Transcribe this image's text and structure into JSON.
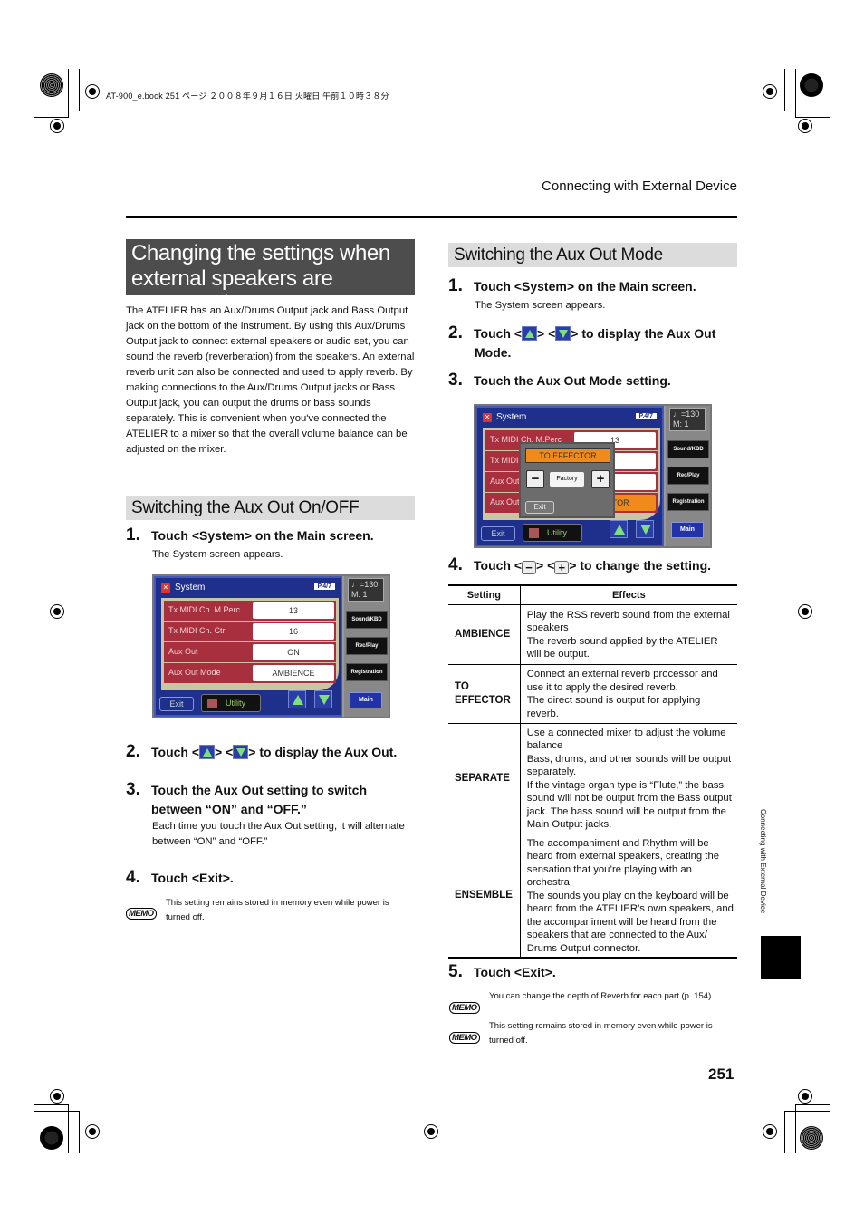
{
  "print_header": "AT-900_e.book  251 ページ  ２００８年９月１６日  火曜日  午前１０時３８分",
  "running_header": "Connecting with External Device",
  "left": {
    "title_lines": [
      "Changing the settings when",
      "external speakers are connected"
    ],
    "intro": "The ATELIER has an Aux/Drums Output jack and Bass Output jack on the bottom of the instrument. By using this Aux/Drums Output jack to connect external speakers or audio set, you can sound the reverb (reverberation) from the speakers. An external reverb unit can also be connected and used to apply reverb. By making connections to the Aux/Drums Output jacks or Bass Output jack, you can output the drums or bass sounds separately. This is convenient when you've connected the ATELIER to a mixer so that the overall volume balance can be adjusted on the mixer.",
    "section": "Switching the Aux Out On/OFF",
    "step1": {
      "num": "1.",
      "text": "Touch <System> on the Main screen.",
      "sub": "The System screen appears."
    },
    "step2": {
      "num": "2.",
      "pre": "Touch <",
      "mid": "> <",
      "post": "> to display the Aux Out."
    },
    "step3": {
      "num": "3.",
      "text": "Touch the Aux Out setting to switch between “ON” and “OFF.”",
      "sub": "Each time you touch the Aux Out setting, it will alternate between “ON” and “OFF.”"
    },
    "step4": {
      "num": "4.",
      "text": "Touch <Exit>."
    },
    "memo": {
      "label": "MEMO",
      "text": "This setting remains stored in memory even while power is turned off."
    }
  },
  "screen": {
    "title": "System",
    "page": "P.4/7",
    "rows": [
      {
        "label": "Tx MIDI Ch. M.Perc",
        "value": "13"
      },
      {
        "label": "Tx MIDI Ch. Ctrl",
        "value": "16"
      },
      {
        "label": "Aux Out",
        "value": "ON"
      },
      {
        "label": "Aux Out Mode",
        "value": "AMBIENCE"
      }
    ],
    "exit": "Exit",
    "utility": "Utility",
    "tempo": "♩=130",
    "measure": "M:   1",
    "side_buttons": [
      "Sound/KBD",
      "Rec/Play",
      "Registration"
    ],
    "main": "Main"
  },
  "screen2": {
    "row_labels": [
      "Tx MIDI Ch. M.Perc",
      "Tx MIDI",
      "Aux Out",
      "Aux Out"
    ],
    "row1_value": "13",
    "row4_value": "ECTOR",
    "popup": {
      "value": "TO EFFECTOR",
      "minus": "−",
      "factory": "Factory",
      "plus": "+",
      "exit": "Exit"
    }
  },
  "right": {
    "section": "Switching the Aux Out Mode",
    "step1": {
      "num": "1.",
      "text": "Touch <System> on the Main screen.",
      "sub": "The System screen appears."
    },
    "step2": {
      "num": "2.",
      "pre": "Touch <",
      "mid": "> <",
      "post": "> to display the Aux Out Mode."
    },
    "step3": {
      "num": "3.",
      "text": "Touch the Aux Out Mode setting."
    },
    "step4": {
      "num": "4.",
      "pre": "Touch <",
      "minus": "−",
      "mid": "> <",
      "plus": "+",
      "post": "> to change the setting."
    },
    "table": {
      "headers": [
        "Setting",
        "Effects"
      ],
      "rows": [
        {
          "setting": "AMBIENCE",
          "effects": [
            "Play the RSS reverb sound from the external speakers",
            "The reverb sound applied by the ATELIER will be output."
          ]
        },
        {
          "setting": "TO EFFECTOR",
          "effects": [
            "Connect an external reverb processor and use it to apply the desired reverb.",
            "The direct sound is output for applying reverb."
          ]
        },
        {
          "setting": "SEPARATE",
          "effects": [
            "Use a connected mixer to adjust the volume balance",
            "Bass, drums, and other sounds will be output separately.",
            "If the vintage organ type is “Flute,” the bass sound will not be output from the Bass output jack. The bass sound will be output from the Main Output jacks."
          ]
        },
        {
          "setting": "ENSEMBLE",
          "effects": [
            "The accompaniment and Rhythm will be heard from external speakers, creating the sensation that you’re playing with an orchestra",
            "The sounds you play on the keyboard will be heard from the ATELIER’s own speakers, and the accompaniment will be heard from the speakers that are connected to the Aux/ Drums Output connector."
          ]
        }
      ]
    },
    "step5": {
      "num": "5.",
      "text": "Touch <Exit>."
    },
    "memo1": {
      "label": "MEMO",
      "text": "You can change the depth of Reverb for each part (p. 154)."
    },
    "memo2": {
      "label": "MEMO",
      "text": "This setting remains stored in memory even while power is turned off."
    }
  },
  "side_tab": "Connecting with External Device",
  "page_number": "251"
}
